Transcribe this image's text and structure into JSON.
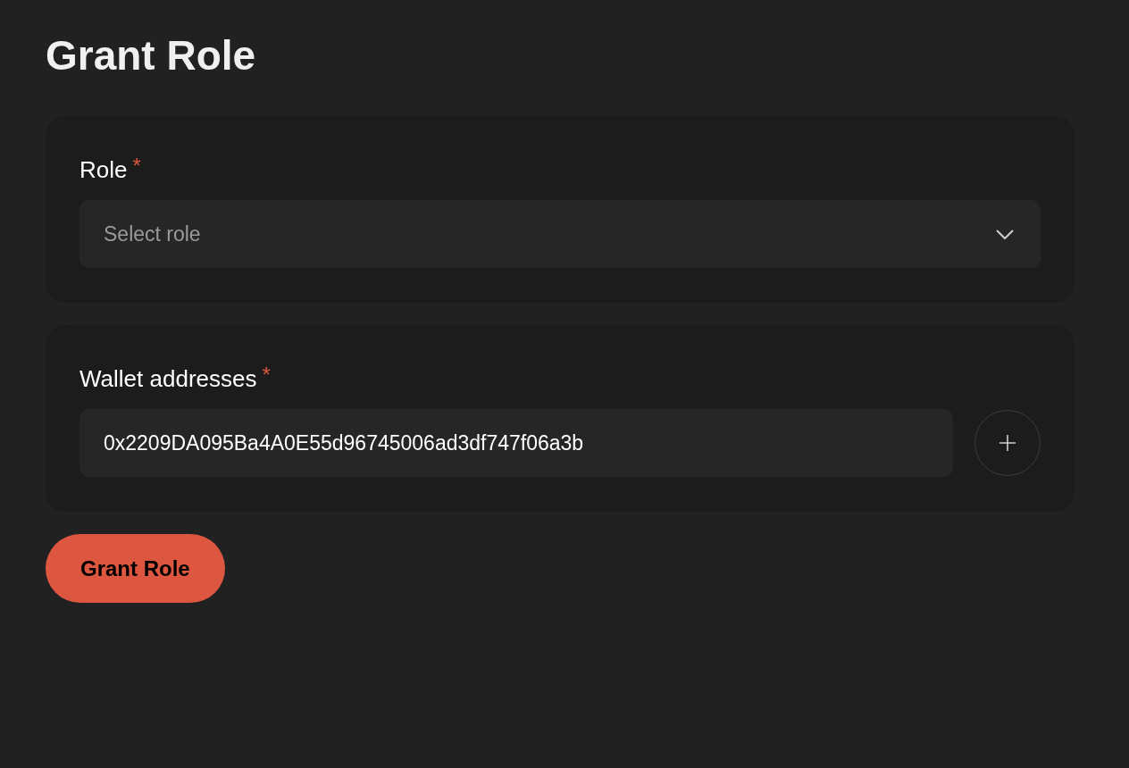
{
  "title": "Grant Role",
  "role": {
    "label": "Role",
    "required_mark": "*",
    "placeholder": "Select role"
  },
  "wallets": {
    "label": "Wallet addresses",
    "required_mark": "*",
    "addresses": [
      "0x2209DA095Ba4A0E55d96745006ad3df747f06a3b"
    ]
  },
  "submit": {
    "label": "Grant Role"
  }
}
